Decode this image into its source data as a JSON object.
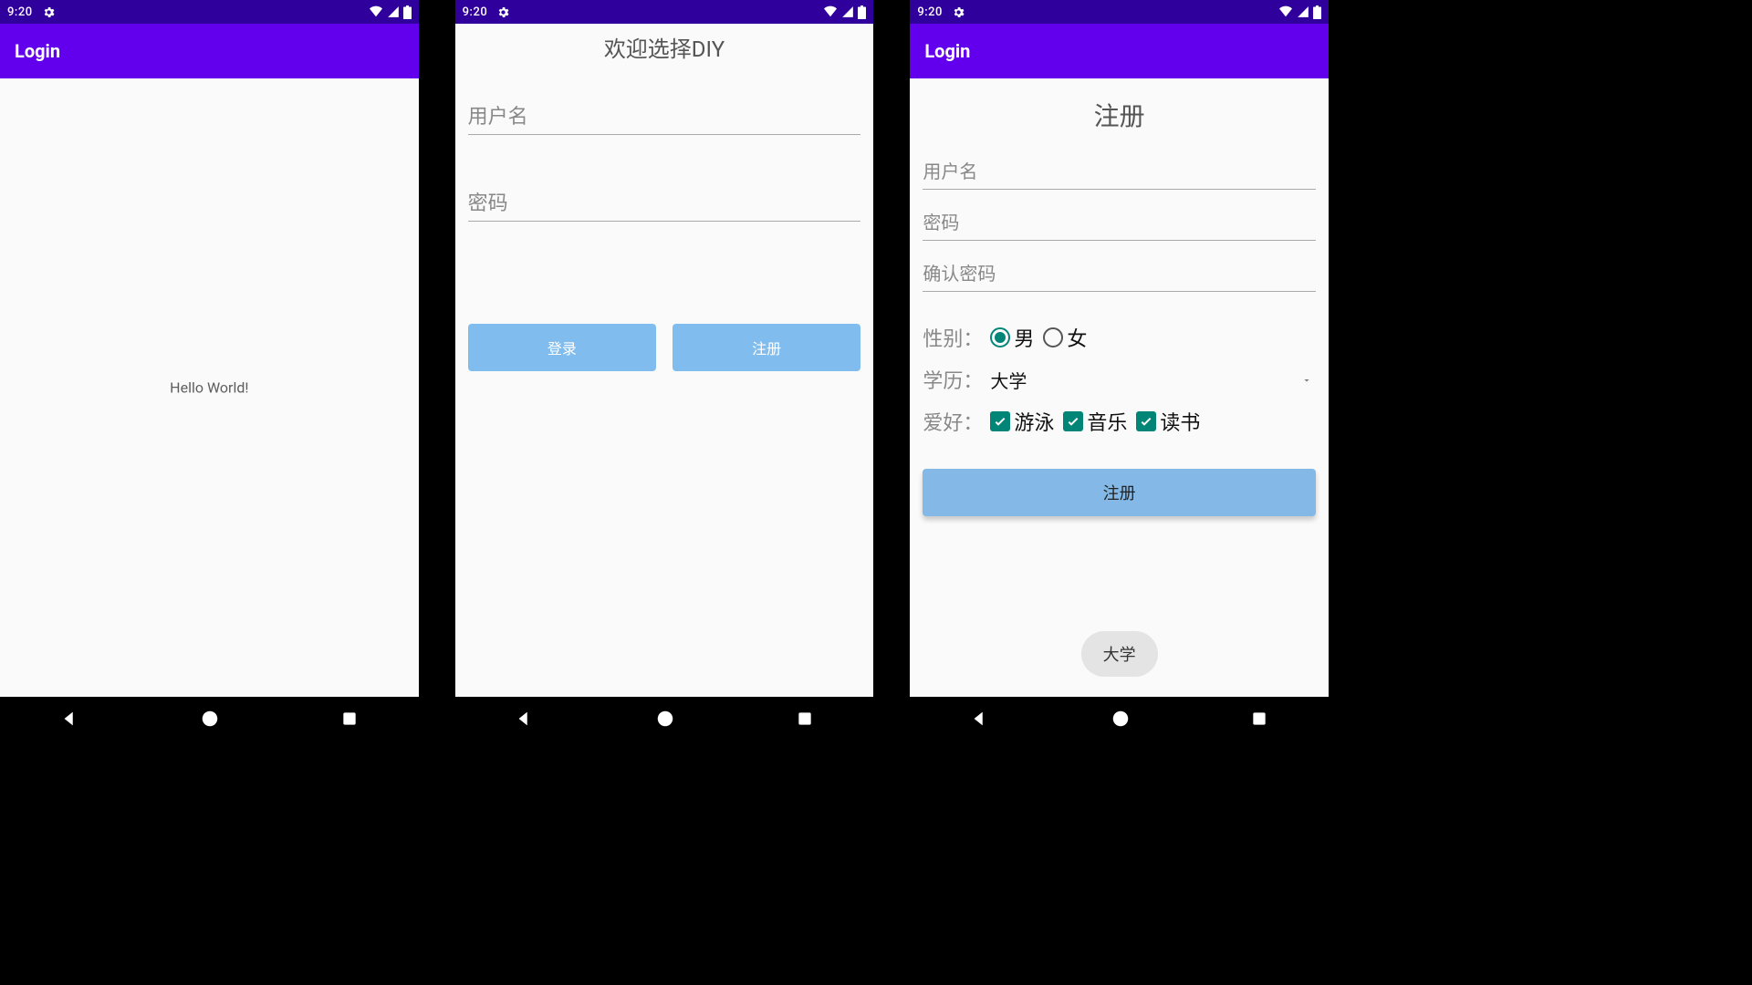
{
  "status": {
    "time": "9:20"
  },
  "colors": {
    "accent": "#6200ee",
    "accent_dark": "#30009c",
    "btn_blue": "#81bcee",
    "teal": "#018577"
  },
  "screen1": {
    "appbar_title": "Login",
    "body_text": "Hello World!"
  },
  "screen2": {
    "title": "欢迎选择DIY",
    "username_placeholder": "用户名",
    "password_placeholder": "密码",
    "login_label": "登录",
    "register_label": "注册"
  },
  "screen3": {
    "appbar_title": "Login",
    "title": "注册",
    "username_placeholder": "用户名",
    "password_placeholder": "密码",
    "confirm_placeholder": "确认密码",
    "gender_label": "性别：",
    "gender_male": "男",
    "gender_female": "女",
    "edu_label": "学历：",
    "edu_value": "大学",
    "hobby_label": "爱好：",
    "hobby_swim": "游泳",
    "hobby_music": "音乐",
    "hobby_read": "读书",
    "submit_label": "注册",
    "toast": "大学"
  }
}
